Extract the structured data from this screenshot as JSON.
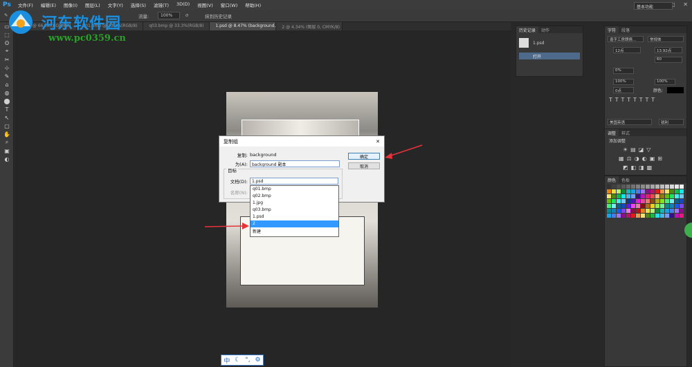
{
  "app": {
    "logo": "Ps"
  },
  "menus": [
    "文件(F)",
    "编辑(E)",
    "图像(I)",
    "图层(L)",
    "文字(Y)",
    "选择(S)",
    "滤镜(T)",
    "3D(D)",
    "视图(V)",
    "窗口(W)",
    "帮助(H)"
  ],
  "options_bar": {
    "opacity_label": "流量:",
    "opacity_value": "100%",
    "history_label": "抹到历史记录"
  },
  "workspace_menu": "基本功能",
  "tabs": [
    "1.jpg @ 66.7%(RGB/8#)",
    "q01.bmp @ 33.3%(RGB/8)",
    "q03.bmp @ 33.3%(RGB/8)",
    "1.psd @ 8.47% (background, CMYK/8)",
    "2 @ 4.34% (图层 0, CMYK/8)"
  ],
  "history_panel": {
    "tabs": [
      "历史记录",
      "动作"
    ],
    "snapshot": "1.psd",
    "state": "打开"
  },
  "character_panel": {
    "tabs": [
      "字符",
      "段落"
    ],
    "font": "造字工房朗倩...",
    "style": "常规体",
    "size": "12点",
    "leading": "13.92点",
    "tracking": "60",
    "scale_v": "100%",
    "scale_h": "100%",
    "baseline": "0点",
    "color_label": "颜色:",
    "lang": "美国英语",
    "aa": "锐利",
    "pct": "0%"
  },
  "adjust_panel": {
    "tabs": [
      "调整",
      "样式"
    ],
    "title": "添加调整"
  },
  "swatch_panel": {
    "tabs": [
      "颜色",
      "色板"
    ]
  },
  "dialog": {
    "title": "复制组",
    "copy_label": "复制:",
    "copy_value": "background",
    "as_label": "为(A):",
    "as_value": "background 副本",
    "group_label": "目标",
    "doc_label": "文档(D):",
    "doc_value": "1.psd",
    "name_label": "名称(N):",
    "ok": "确定",
    "cancel": "取消"
  },
  "dropdown": {
    "options": [
      "q01.bmp",
      "q02.bmp",
      "1.jpg",
      "q03.bmp",
      "1.psd",
      "2",
      "新建"
    ],
    "selected": "2"
  },
  "watermark": {
    "title": "河东软件园",
    "url": "www.pc0359.cn"
  },
  "ime": {
    "mode": "中"
  },
  "colors": {
    "arrow": "#e8323a",
    "accent": "#3399ff"
  }
}
